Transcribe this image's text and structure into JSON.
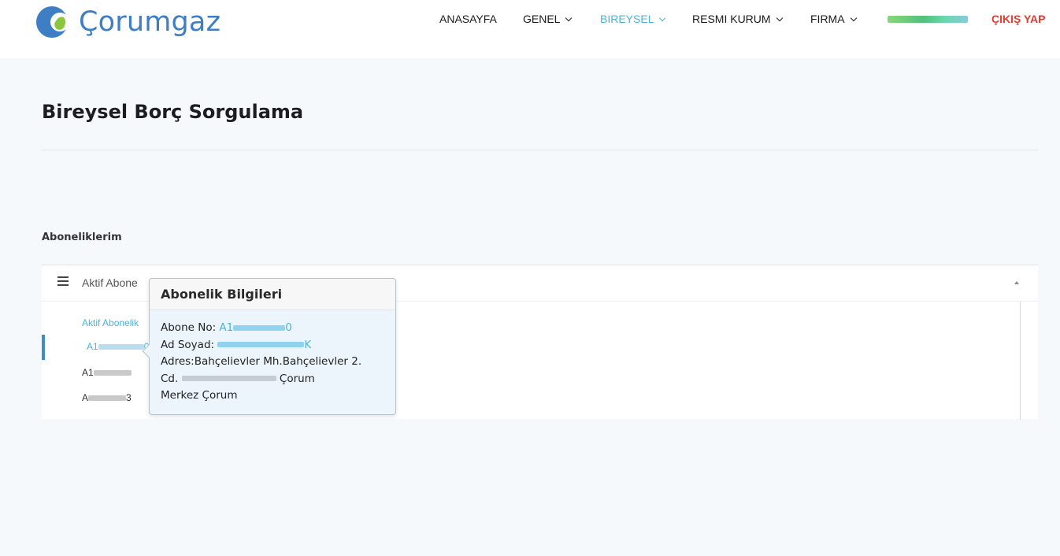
{
  "header": {
    "logo_text": "Çorumgaz",
    "nav": [
      {
        "label": "ANASAYFA",
        "has_dropdown": false
      },
      {
        "label": "GENEL",
        "has_dropdown": true
      },
      {
        "label": "BIREYSEL",
        "has_dropdown": true,
        "active": true
      },
      {
        "label": "RESMI KURUM",
        "has_dropdown": true
      },
      {
        "label": "FIRMA",
        "has_dropdown": true
      }
    ],
    "exit_label": "ÇIKIŞ YAP",
    "accent_color": "#4ab3e0",
    "exit_color": "#e53a2f"
  },
  "page": {
    "title": "Bireysel Borç Sorgulama",
    "section_label": "Aboneliklerim"
  },
  "panel": {
    "title": "Aktif Abone",
    "sub_link": "Aktif Abonelik",
    "accounts": [
      {
        "prefix": "A1",
        "suffix": "0",
        "selected": true
      },
      {
        "prefix": "A1",
        "suffix": "",
        "selected": false
      },
      {
        "prefix": "A",
        "suffix": "3",
        "selected": false
      }
    ]
  },
  "popover": {
    "title": "Abonelik Bilgileri",
    "abone_no_label": "Abone No:",
    "abone_no_prefix": "A1",
    "abone_no_suffix": "0",
    "ad_soyad_label": "Ad Soyad:",
    "ad_soyad_suffix": "K",
    "address_line1": "Adres:Bahçelievler Mh.Bahçelievler 2.",
    "address_line2_prefix": "Cd.",
    "address_line2_suffix": "Çorum",
    "address_line3": "Merkez Çorum"
  }
}
